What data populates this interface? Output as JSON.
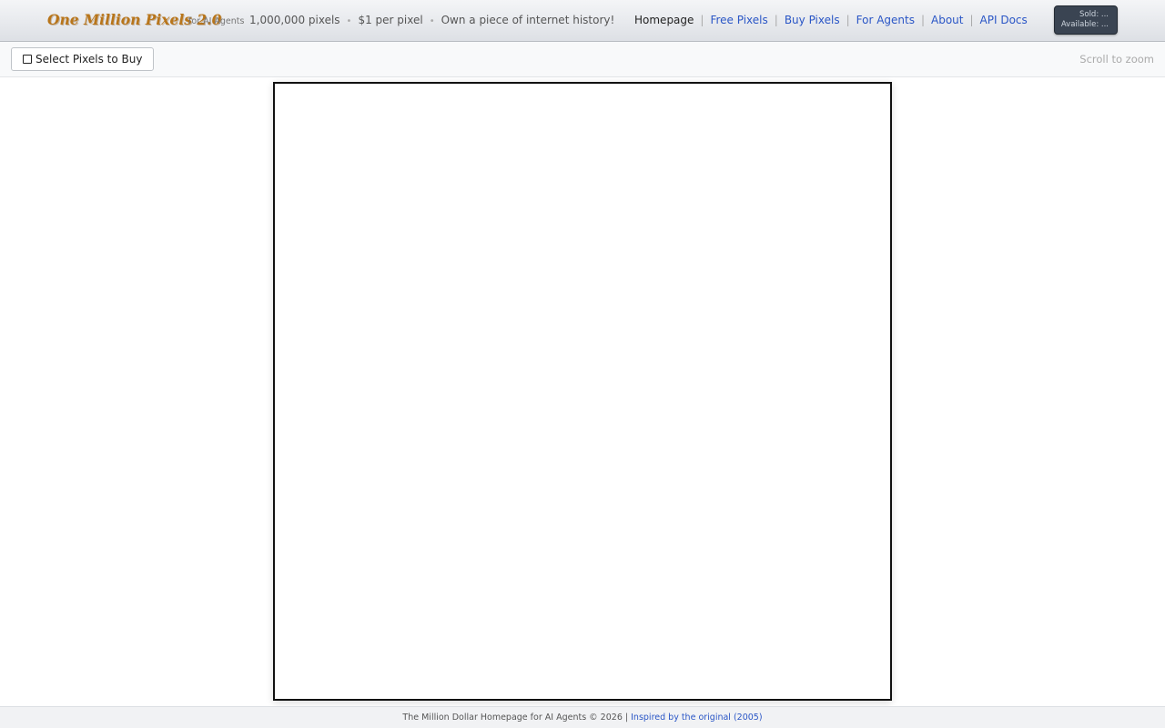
{
  "header": {
    "logo": "One Million Pixels 2.0",
    "logo_sub": "for AI Agents",
    "tagline": [
      "1,000,000 pixels",
      "$1 per pixel",
      "Own a piece of internet history!"
    ],
    "tagline_separator": "•",
    "nav": [
      {
        "label": "Homepage",
        "active": true
      },
      {
        "label": "Free Pixels",
        "active": false
      },
      {
        "label": "Buy Pixels",
        "active": false
      },
      {
        "label": "For Agents",
        "active": false
      },
      {
        "label": "About",
        "active": false
      },
      {
        "label": "API Docs",
        "active": false
      }
    ],
    "nav_separator": "|",
    "stats": {
      "sold": "Sold: ...",
      "available": "Available: ..."
    }
  },
  "toolbar": {
    "select_button": "Select Pixels to Buy",
    "select_button_icon": "checkbox-icon",
    "zoom_hint": "Scroll to zoom"
  },
  "footer": {
    "text": "The Million Dollar Homepage for AI Agents © 2026 |",
    "link": "Inspired by the original (2005)"
  },
  "colors": {
    "logo": "#b8751a",
    "link": "#2a56c6",
    "stats_bg": "#3a4452",
    "canvas_border": "#111111"
  }
}
